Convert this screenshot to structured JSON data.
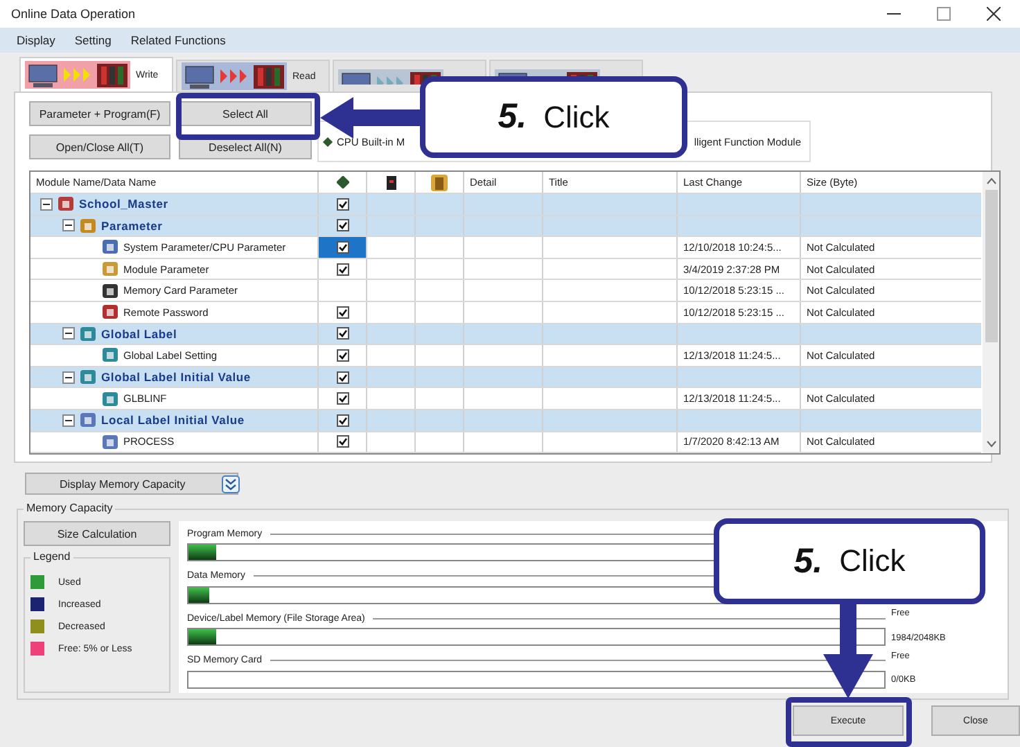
{
  "window": {
    "title": "Online Data Operation"
  },
  "menu": [
    "Display",
    "Setting",
    "Related Functions"
  ],
  "tabs": [
    {
      "label": "Write",
      "kind": "write",
      "selected": true
    },
    {
      "label": "Read",
      "kind": "read",
      "selected": false
    },
    {
      "kind": "verify",
      "selected": false
    },
    {
      "kind": "delete",
      "selected": false
    }
  ],
  "buttons": {
    "param_program": "Parameter + Program(F)",
    "select_all": "Select All",
    "open_close": "Open/Close All(T)",
    "deselect_all": "Deselect All(N)"
  },
  "subtabs": [
    "CPU Built-in M",
    "lligent Function Module"
  ],
  "table": {
    "columns": [
      "Module Name/Data Name",
      "Detail",
      "Title",
      "Last Change",
      "Size (Byte)"
    ],
    "rows": [
      {
        "name": "School_Master",
        "kind": "project",
        "checked": true,
        "selected": false,
        "children": [
          {
            "name": "Parameter",
            "kind": "parameter",
            "checked": true,
            "selected": false,
            "children": [
              {
                "name": "System Parameter/CPU Parameter",
                "kind": "system-parameter",
                "checked": true,
                "selected": true,
                "last_change": "12/10/2018 10:24:5...",
                "size": "Not Calculated"
              },
              {
                "name": "Module Parameter",
                "kind": "module-parameter",
                "checked": true,
                "selected": false,
                "last_change": "3/4/2019 2:37:28 PM",
                "size": "Not Calculated"
              },
              {
                "name": "Memory Card Parameter",
                "kind": "memory-card",
                "checked": false,
                "selected": false,
                "last_change": "10/12/2018 5:23:15 ...",
                "size": "Not Calculated"
              },
              {
                "name": "Remote Password",
                "kind": "password",
                "checked": true,
                "selected": false,
                "last_change": "10/12/2018 5:23:15 ...",
                "size": "Not Calculated"
              }
            ]
          },
          {
            "name": "Global Label",
            "kind": "label",
            "checked": true,
            "selected": false,
            "children": [
              {
                "name": "Global Label Setting",
                "kind": "label",
                "checked": true,
                "selected": false,
                "last_change": "12/13/2018 11:24:5...",
                "size": "Not Calculated"
              }
            ]
          },
          {
            "name": "Global Label Initial Value",
            "kind": "label",
            "checked": true,
            "selected": false,
            "children": [
              {
                "name": "GLBLINF",
                "kind": "label",
                "checked": true,
                "selected": false,
                "last_change": "12/13/2018 11:24:5...",
                "size": "Not Calculated"
              }
            ]
          },
          {
            "name": "Local Label Initial Value",
            "kind": "local-label",
            "checked": true,
            "selected": false,
            "children": [
              {
                "name": "PROCESS",
                "kind": "local-label",
                "checked": true,
                "selected": false,
                "last_change": "1/7/2020 8:42:13 AM",
                "size": "Not Calculated"
              }
            ]
          }
        ]
      }
    ]
  },
  "display_memory_button": "Display Memory Capacity",
  "memory": {
    "title": "Memory Capacity",
    "size_calculation": "Size Calculation",
    "legend_title": "Legend",
    "legend": [
      {
        "label": "Used",
        "color": "#2e9a3a"
      },
      {
        "label": "Increased",
        "color": "#1c2370"
      },
      {
        "label": "Decreased",
        "color": "#8f8f1e"
      },
      {
        "label": "Free: 5% or Less",
        "color": "#f0407a"
      }
    ],
    "rows": [
      {
        "name": "Program Memory",
        "level": 0.04
      },
      {
        "name": "Data Memory",
        "level": 0.03
      },
      {
        "name": "Device/Label Memory (File Storage Area)",
        "level": 0.04,
        "free_label": "Free",
        "free_value": "1984/2048KB"
      },
      {
        "name": "SD Memory Card",
        "free_label": "Free",
        "free_value": "0/0KB"
      }
    ]
  },
  "footer": {
    "execute": "Execute",
    "close": "Close"
  },
  "callouts": [
    {
      "number": "5.",
      "text": "Click",
      "kind": "left"
    },
    {
      "number": "5.",
      "text": "Click",
      "kind": "down"
    }
  ]
}
